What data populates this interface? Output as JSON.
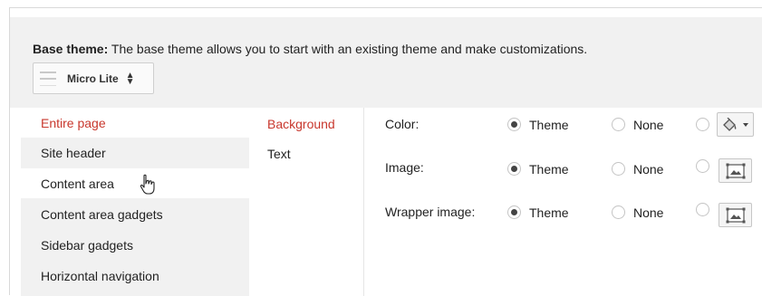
{
  "base_theme": {
    "label": "Base theme:",
    "description": "The base theme allows you to start with an existing theme and make customizations.",
    "selected_theme": "Micro Lite"
  },
  "page_sections": [
    {
      "label": "Entire page",
      "selected": true
    },
    {
      "label": "Site header",
      "selected": false
    },
    {
      "label": "Content area",
      "selected": false,
      "hovered": true
    },
    {
      "label": "Content area gadgets",
      "selected": false
    },
    {
      "label": "Sidebar gadgets",
      "selected": false
    },
    {
      "label": "Horizontal navigation",
      "selected": false
    }
  ],
  "sub_sections": [
    {
      "label": "Background",
      "selected": true
    },
    {
      "label": "Text",
      "selected": false
    }
  ],
  "settings": [
    {
      "label": "Color:",
      "theme_label": "Theme",
      "none_label": "None",
      "selected": "theme",
      "custom_icon": "paint-bucket-icon"
    },
    {
      "label": "Image:",
      "theme_label": "Theme",
      "none_label": "None",
      "selected": "theme",
      "custom_icon": "image-icon"
    },
    {
      "label": "Wrapper image:",
      "theme_label": "Theme",
      "none_label": "None",
      "selected": "theme",
      "custom_icon": "image-icon"
    }
  ],
  "colors": {
    "selected_text": "#c8372d",
    "panel_bg": "#f1f1f1"
  }
}
